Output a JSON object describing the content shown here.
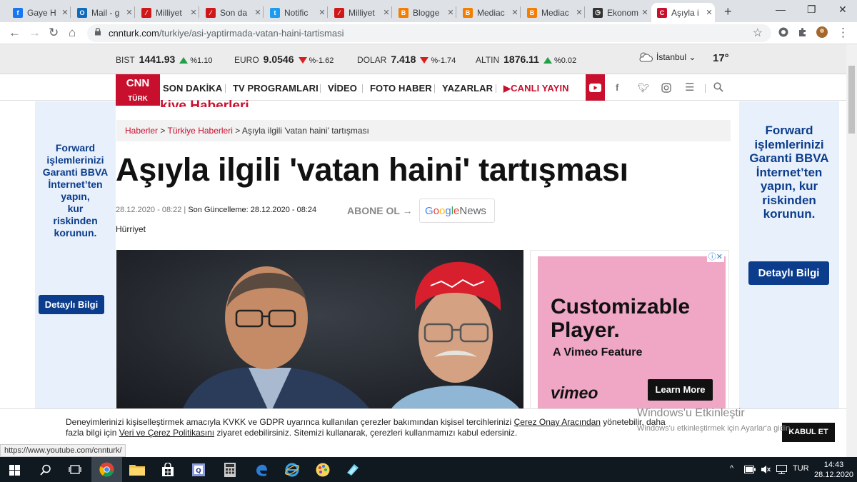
{
  "browser": {
    "tabs": [
      {
        "label": "Gaye H",
        "icon": "facebook-icon",
        "color": "#1877f2",
        "glyph": "f"
      },
      {
        "label": "Mail - g",
        "icon": "outlook-icon",
        "color": "#0f6cbd",
        "glyph": "O"
      },
      {
        "label": "Milliyet",
        "icon": "milliyet-icon",
        "color": "#d01818",
        "glyph": "⁄"
      },
      {
        "label": "Son da",
        "icon": "milliyet-icon",
        "color": "#d01818",
        "glyph": "⁄"
      },
      {
        "label": "Notific",
        "icon": "twitter-icon",
        "color": "#1d9bf0",
        "glyph": "t"
      },
      {
        "label": "Milliyet",
        "icon": "milliyet-icon",
        "color": "#d01818",
        "glyph": "⁄"
      },
      {
        "label": "Blogge",
        "icon": "blogger-icon",
        "color": "#f57d00",
        "glyph": "B"
      },
      {
        "label": "Mediac",
        "icon": "blogger-icon",
        "color": "#f57d00",
        "glyph": "B"
      },
      {
        "label": "Mediac",
        "icon": "blogger-icon",
        "color": "#f57d00",
        "glyph": "B"
      },
      {
        "label": "Ekonom",
        "icon": "clock-icon",
        "color": "#333333",
        "glyph": "◷"
      },
      {
        "label": "Aşıyla i",
        "icon": "cnn-icon",
        "color": "#c8102e",
        "glyph": "C"
      }
    ],
    "url_host": "cnnturk.com",
    "url_path": "/turkiye/asi-yaptirmada-vatan-haini-tartismasi",
    "status_url": "https://www.youtube.com/cnnturk/"
  },
  "ticker": {
    "items": [
      {
        "name": "BIST",
        "value": "1441.93",
        "change": "%1.10",
        "dir": "up"
      },
      {
        "name": "EURO",
        "value": "9.0546",
        "change": "%-1.62",
        "dir": "down"
      },
      {
        "name": "DOLAR",
        "value": "7.418",
        "change": "%-1.74",
        "dir": "down"
      },
      {
        "name": "ALTIN",
        "value": "1876.11",
        "change": "%0.02",
        "dir": "up"
      }
    ],
    "city": "İstanbul",
    "temperature": "17°"
  },
  "nav": {
    "logo_text": "CNN",
    "logo_sub": "TÜRK",
    "items": [
      "SON DAKİKA",
      "TV PROGRAMLARI",
      "VİDEO",
      "FOTO HABER",
      "YAZARLAR"
    ],
    "live_label": "CANLI YAYIN"
  },
  "side_ad": {
    "text": "Forward işlemlerinizi Garanti BBVA İnternet’ten yapın, kur riskinden korunun.",
    "left_lines": [
      "Forward",
      "işlemlerinizi",
      "Garanti BBVA",
      "İnternet’ten",
      "yapın,",
      "kur",
      "riskinden",
      "korunun."
    ],
    "button": "Detaylı Bilgi"
  },
  "article": {
    "section_partial": "kiye Haberleri",
    "breadcrumb": {
      "home": "Haberler",
      "sep": ">",
      "section": "Türkiye Haberleri",
      "current": "Aşıyla ilgili 'vatan haini' tartışması"
    },
    "headline": "Aşıyla ilgili 'vatan haini' tartışması",
    "published": "28.12.2020 - 08:22",
    "updated": "Son Güncelleme: 28.12.2020 - 08:24",
    "subscribe": "ABONE OL",
    "google_news": "Google News",
    "source": "Hürriyet"
  },
  "ad": {
    "headline": "Customizable Player.",
    "sub": "A Vimeo Feature",
    "brand": "vimeo",
    "cta": "Learn More"
  },
  "cookie": {
    "text_1": "Deneyimlerinizi kişiselleştirmek amacıyla KVKK ve GDPR uyarınca kullanılan çerezler bakımından kişisel tercihlerinizi ",
    "link_1": "Çerez Onay Aracından",
    "text_2": " yönetebilir, daha fazla bilgi için ",
    "link_2": "Veri ve Çerez Politikasını",
    "text_3": " ziyaret edebilirsiniz. Sitemizi kullanarak, çerezleri kullanmamızı kabul edersiniz.",
    "accept": "KABUL ET"
  },
  "watermark": {
    "line1": "Windows'u Etkinleştir",
    "line2": "Windows'u etkinleştirmek için Ayarlar'a gidin."
  },
  "taskbar": {
    "lang": "TUR",
    "time": "14:43",
    "date": "28.12.2020"
  }
}
